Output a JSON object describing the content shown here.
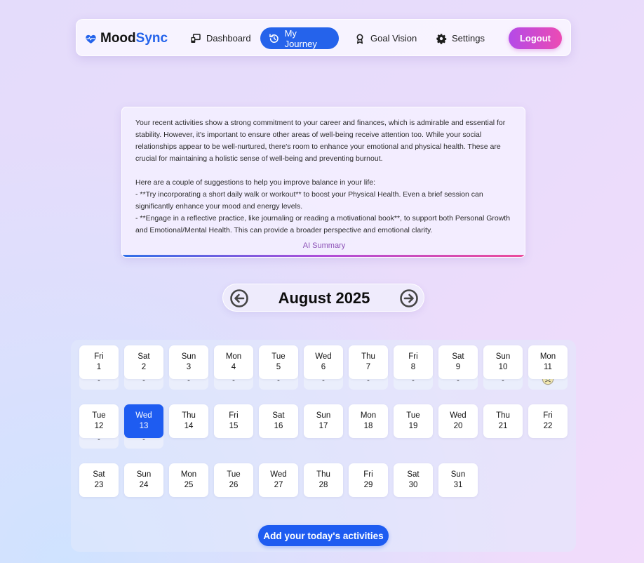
{
  "brand": {
    "part1": "Mood",
    "part2": "Sync"
  },
  "nav": {
    "dashboard": "Dashboard",
    "journey": "My Journey",
    "goal": "Goal Vision",
    "settings": "Settings",
    "logout": "Logout"
  },
  "summary": {
    "paragraph1": "Your recent activities show a strong commitment to your career and finances, which is admirable and essential for stability. However, it's important to ensure other areas of well-being receive attention too. While your social relationships appear to be well-nurtured, there's room to enhance your emotional and physical health. These are crucial for maintaining a holistic sense of well-being and preventing burnout.",
    "intro": "Here are a couple of suggestions to help you improve balance in your life:",
    "tip1": "- **Try incorporating a short daily walk or workout** to boost your Physical Health. Even a brief session can significantly enhance your mood and energy levels.",
    "tip2": "- **Engage in a reflective practice, like journaling or reading a motivational book**, to support both Personal Growth and Emotional/Mental Health. This can provide a broader perspective and emotional clarity.",
    "label": "AI Summary"
  },
  "calendar": {
    "month_label": "August 2025",
    "days": [
      {
        "wd": "Fri",
        "d": "1",
        "mood": "-"
      },
      {
        "wd": "Sat",
        "d": "2",
        "mood": "-"
      },
      {
        "wd": "Sun",
        "d": "3",
        "mood": "-"
      },
      {
        "wd": "Mon",
        "d": "4",
        "mood": "-"
      },
      {
        "wd": "Tue",
        "d": "5",
        "mood": "-"
      },
      {
        "wd": "Wed",
        "d": "6",
        "mood": "-"
      },
      {
        "wd": "Thu",
        "d": "7",
        "mood": "-"
      },
      {
        "wd": "Fri",
        "d": "8",
        "mood": "-"
      },
      {
        "wd": "Sat",
        "d": "9",
        "mood": "-"
      },
      {
        "wd": "Sun",
        "d": "10",
        "mood": "-"
      },
      {
        "wd": "Mon",
        "d": "11",
        "mood_icon": "sad-face-icon"
      },
      {
        "wd": "Tue",
        "d": "12",
        "mood": "-"
      },
      {
        "wd": "Wed",
        "d": "13",
        "mood": "-",
        "selected": true
      },
      {
        "wd": "Thu",
        "d": "14"
      },
      {
        "wd": "Fri",
        "d": "15"
      },
      {
        "wd": "Sat",
        "d": "16"
      },
      {
        "wd": "Sun",
        "d": "17"
      },
      {
        "wd": "Mon",
        "d": "18"
      },
      {
        "wd": "Tue",
        "d": "19"
      },
      {
        "wd": "Wed",
        "d": "20"
      },
      {
        "wd": "Thu",
        "d": "21"
      },
      {
        "wd": "Fri",
        "d": "22"
      },
      {
        "wd": "Sat",
        "d": "23"
      },
      {
        "wd": "Sun",
        "d": "24"
      },
      {
        "wd": "Mon",
        "d": "25"
      },
      {
        "wd": "Tue",
        "d": "26"
      },
      {
        "wd": "Wed",
        "d": "27"
      },
      {
        "wd": "Thu",
        "d": "28"
      },
      {
        "wd": "Fri",
        "d": "29"
      },
      {
        "wd": "Sat",
        "d": "30"
      },
      {
        "wd": "Sun",
        "d": "31"
      }
    ]
  },
  "add_button": "Add your today's activities",
  "colors": {
    "accent": "#1e5cf1",
    "brand_sync": "#2463eb",
    "logout_from": "#b44ae8",
    "logout_to": "#ec4bb3"
  }
}
